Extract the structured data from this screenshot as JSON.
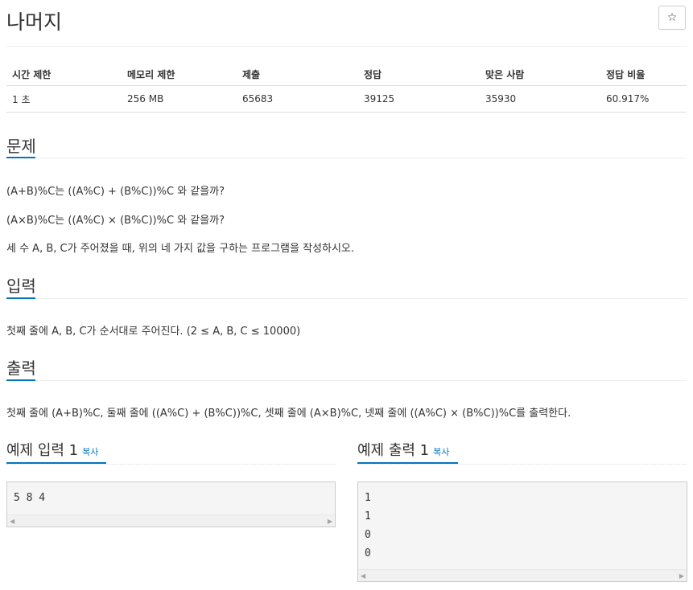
{
  "problem": {
    "title": "나머지",
    "star_icon": "☆"
  },
  "info_table": {
    "headers": [
      "시간 제한",
      "메모리 제한",
      "제출",
      "정답",
      "맞은 사람",
      "정답 비율"
    ],
    "values": [
      "1 초",
      "256 MB",
      "65683",
      "39125",
      "35930",
      "60.917%"
    ]
  },
  "sections": {
    "problem": {
      "heading": "문제",
      "paragraphs": [
        "(A+B)%C는 ((A%C) + (B%C))%C 와 같을까?",
        "(A×B)%C는 ((A%C) × (B%C))%C 와 같을까?",
        "세 수 A, B, C가 주어졌을 때, 위의 네 가지 값을 구하는 프로그램을 작성하시오."
      ]
    },
    "input": {
      "heading": "입력",
      "paragraph": "첫째 줄에 A, B, C가 순서대로 주어진다. (2 ≤ A, B, C ≤ 10000)"
    },
    "output": {
      "heading": "출력",
      "paragraph": "첫째 줄에 (A+B)%C, 둘째 줄에 ((A%C) + (B%C))%C, 셋째 줄에 (A×B)%C, 넷째 줄에 ((A%C) × (B%C))%C를 출력한다."
    }
  },
  "samples": {
    "input": {
      "heading": "예제 입력 1",
      "copy_label": "복사",
      "lines": [
        "5 8 4"
      ]
    },
    "output": {
      "heading": "예제 출력 1",
      "copy_label": "복사",
      "lines": [
        "1",
        "1",
        "0",
        "0"
      ]
    },
    "scroll_left": "◀",
    "scroll_right": "▶"
  }
}
